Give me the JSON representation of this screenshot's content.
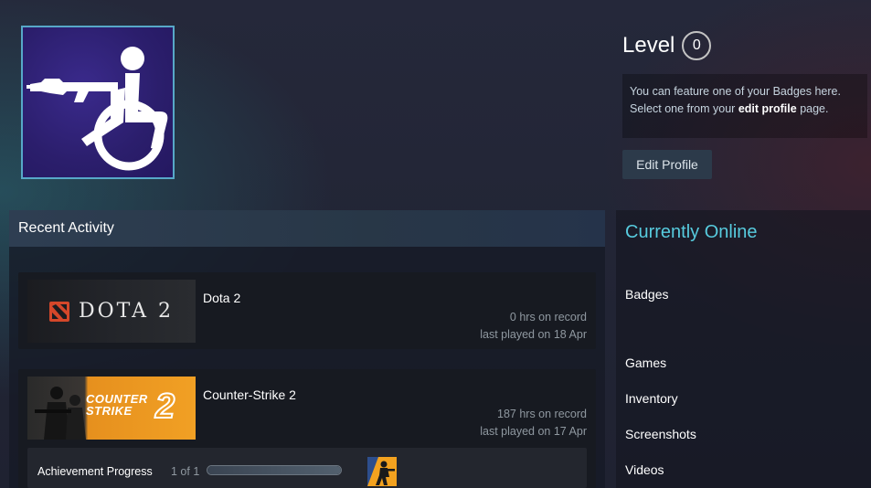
{
  "profile": {
    "level_label": "Level",
    "level_value": "0",
    "badge_text_prefix": "You can feature one of your Badges here. Select one from your ",
    "badge_link": "edit profile",
    "badge_text_suffix": " page.",
    "edit_button": "Edit Profile"
  },
  "recent_activity": {
    "title": "Recent Activity",
    "games": [
      {
        "name": "Dota 2",
        "capsule_text": "DOTA 2",
        "hours": "0 hrs on record",
        "last_played": "last played on 18 Apr"
      },
      {
        "name": "Counter-Strike 2",
        "capsule_line1": "COUNTER",
        "capsule_line2": "STRIKE",
        "capsule_number": "2",
        "hours": "187 hrs on record",
        "last_played": "last played on 17 Apr",
        "achievement_label": "Achievement Progress",
        "achievement_count": "1 of 1",
        "achievement_progress": 1.0
      }
    ]
  },
  "sidebar": {
    "status": "Currently Online",
    "links": [
      "Badges",
      "Games",
      "Inventory",
      "Screenshots",
      "Videos"
    ]
  },
  "colors": {
    "status_online": "#57cbde",
    "avatar_bg": "#2b1e6c",
    "avatar_border": "#57a8c8"
  }
}
